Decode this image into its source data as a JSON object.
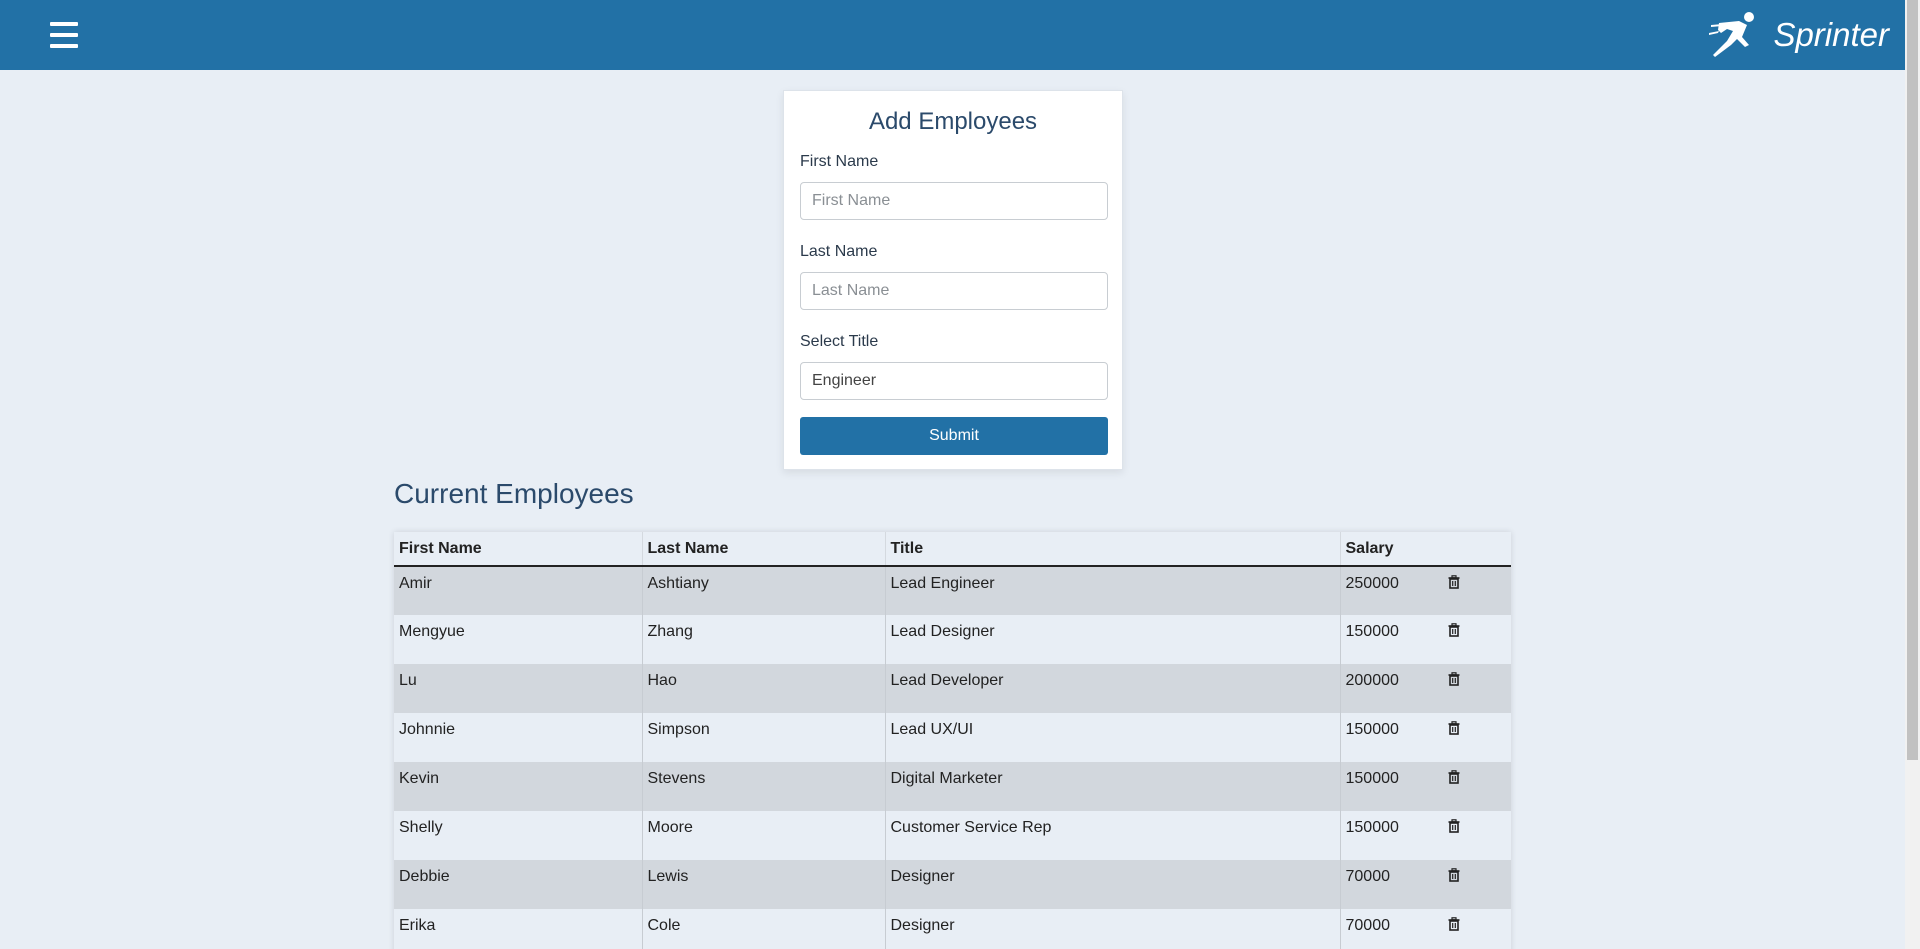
{
  "header": {
    "brand_name": "Sprinter",
    "menu_icon": "hamburger-icon",
    "logo_icon": "running-person-logo",
    "background_color": "#2271a6"
  },
  "form": {
    "title": "Add Employees",
    "first_name_label": "First Name",
    "first_name_placeholder": "First Name",
    "first_name_value": "",
    "last_name_label": "Last Name",
    "last_name_placeholder": "Last Name",
    "last_name_value": "",
    "title_label": "Select Title",
    "title_selected": "Engineer",
    "submit_label": "Submit"
  },
  "employees": {
    "section_title": "Current Employees",
    "columns": [
      "First Name",
      "Last Name",
      "Title",
      "Salary",
      ""
    ],
    "rows": [
      {
        "first": "Amir",
        "last": "Ashtiany",
        "title": "Lead Engineer",
        "salary": "250000"
      },
      {
        "first": "Mengyue",
        "last": "Zhang",
        "title": "Lead Designer",
        "salary": "150000"
      },
      {
        "first": "Lu",
        "last": "Hao",
        "title": "Lead Developer",
        "salary": "200000"
      },
      {
        "first": "Johnnie",
        "last": "Simpson",
        "title": "Lead UX/UI",
        "salary": "150000"
      },
      {
        "first": "Kevin",
        "last": "Stevens",
        "title": "Digital Marketer",
        "salary": "150000"
      },
      {
        "first": "Shelly",
        "last": "Moore",
        "title": "Customer Service Rep",
        "salary": "150000"
      },
      {
        "first": "Debbie",
        "last": "Lewis",
        "title": "Designer",
        "salary": "70000"
      },
      {
        "first": "Erika",
        "last": "Cole",
        "title": "Designer",
        "salary": "70000"
      }
    ],
    "delete_icon": "trash-icon"
  }
}
